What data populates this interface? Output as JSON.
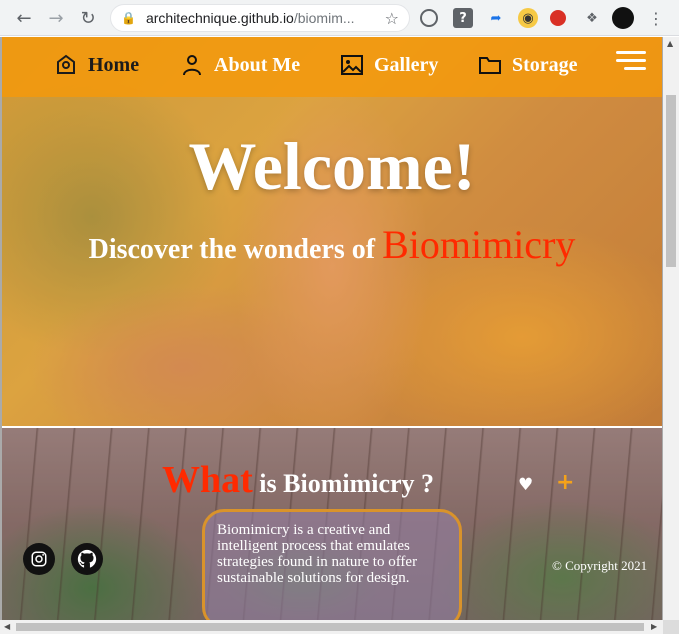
{
  "browser": {
    "url_host": "architechnique.github.io",
    "url_path": "/biomim..."
  },
  "nav": {
    "items": [
      {
        "label": "Home",
        "icon": "home-icon"
      },
      {
        "label": "About Me",
        "icon": "person-icon"
      },
      {
        "label": "Gallery",
        "icon": "image-icon"
      },
      {
        "label": "Storage",
        "icon": "folder-icon"
      }
    ]
  },
  "hero": {
    "welcome": "Welcome!",
    "subtitle_prefix": "Discover the wonders of",
    "subtitle_accent": "Biomimicry"
  },
  "section": {
    "heading_accent": "What",
    "heading_rest": "is Biomimicry ?",
    "card_text": "Biomimicry is a creative and intelligent process that emulates strategies found in nature to offer sustainable solutions for design."
  },
  "footer": {
    "copyright": "© Copyright 2021",
    "social": [
      "instagram-icon",
      "github-icon"
    ]
  },
  "colors": {
    "nav_bg": "#f5980a",
    "accent_red": "#ff2a00",
    "accent_orange": "#f5a21a",
    "card_border": "#d9932b"
  }
}
